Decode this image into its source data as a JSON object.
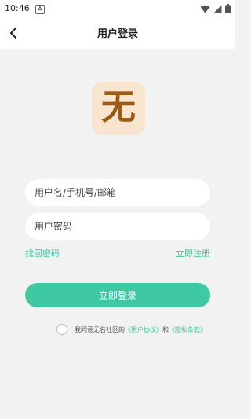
{
  "status_bar": {
    "time": "10:46",
    "notif_icon": "A"
  },
  "header": {
    "title": "用户登录"
  },
  "logo": {
    "text": "无"
  },
  "form": {
    "account_placeholder": "用户名/手机号/邮箱",
    "password_placeholder": "用户密码",
    "find_password": "找回密码",
    "register": "立即注册",
    "login_button": "立即登录"
  },
  "agreement": {
    "prefix": "我同意无名社区的",
    "user_agreement": "《用户协议》",
    "and": "和",
    "privacy": "《隐私条款》"
  },
  "colors": {
    "accent": "#3fc9a2",
    "background": "#f2f2f2",
    "logo_bg": "#f8e4cf",
    "logo_fg": "#9b5a16"
  }
}
